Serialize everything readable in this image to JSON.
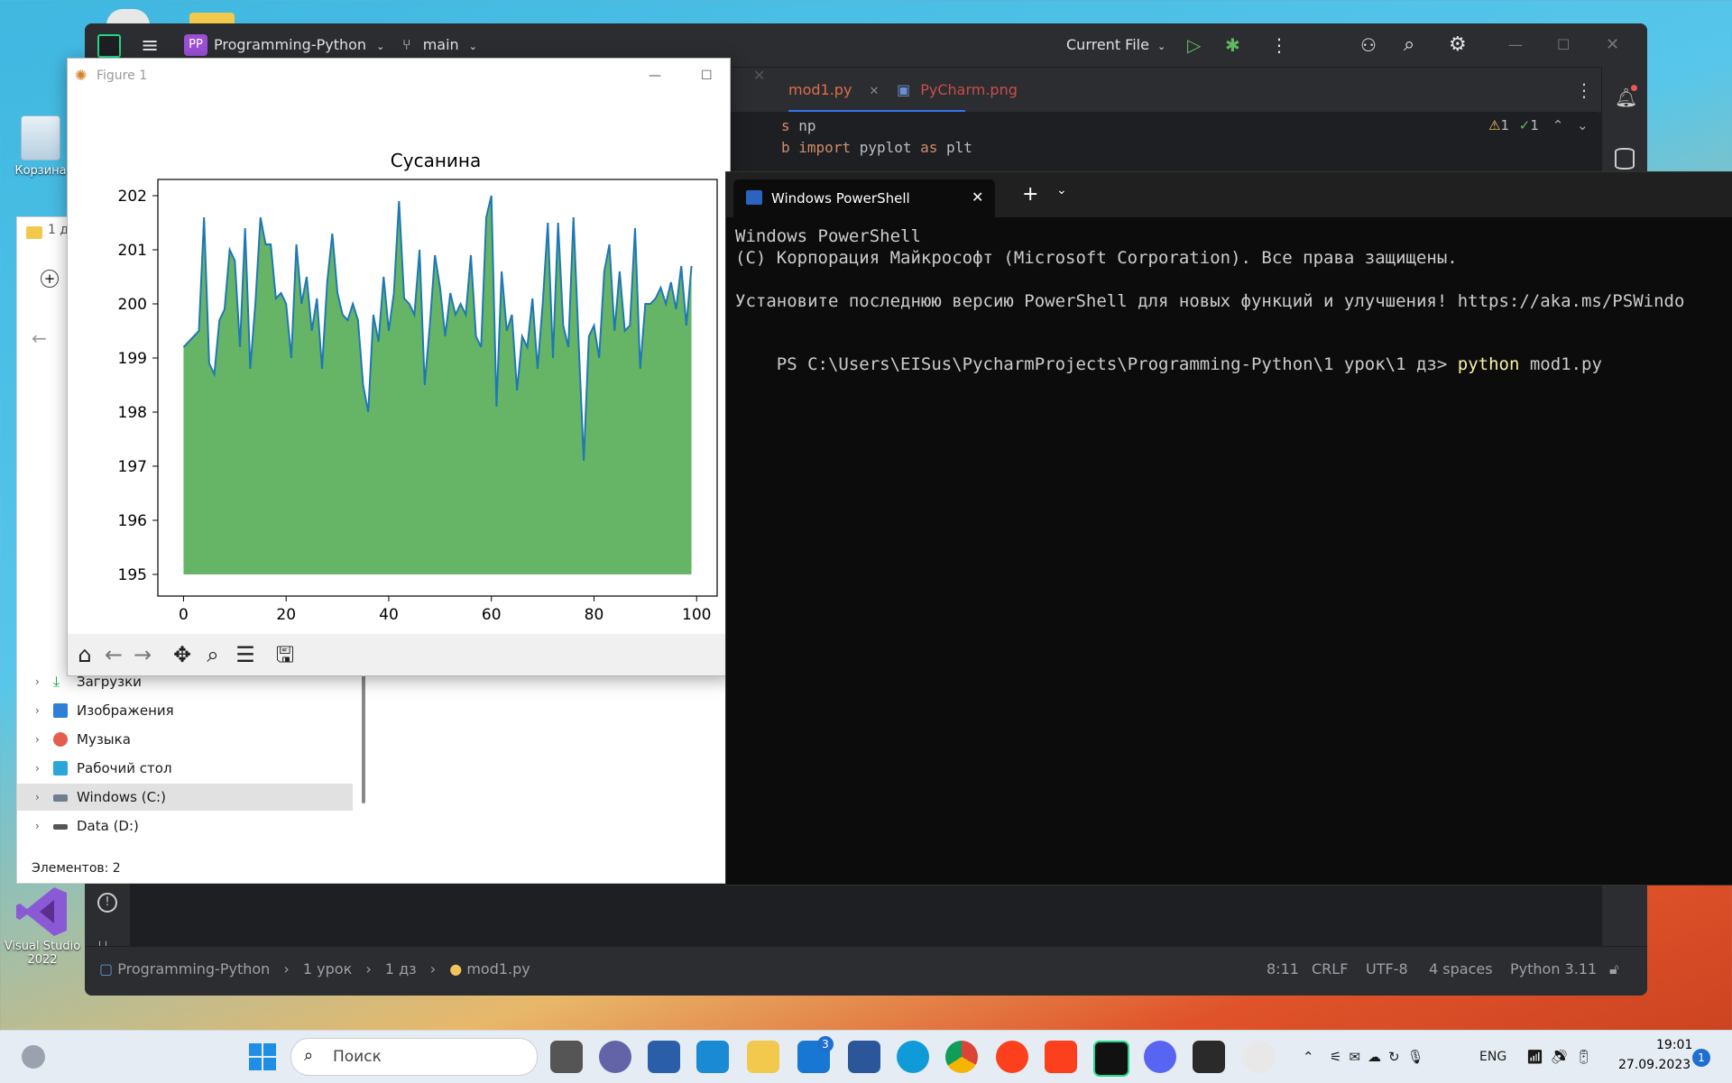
{
  "desktop": {
    "recycle_bin_label": "Корзина",
    "vs_label_1": "Visual Studio",
    "vs_label_2": "2022"
  },
  "pycharm": {
    "project_badge": "PP",
    "project_name": "Programming-Python",
    "branch": "main",
    "run_config": "Current File",
    "tabs": [
      {
        "label": "mod1.py",
        "active": true
      },
      {
        "label": "PyCharm.png",
        "active": false
      }
    ],
    "code_lines": [
      {
        "kw": "s",
        "rest": " np"
      },
      {
        "kw": "b",
        "kw2": "import",
        "rest": " pyplot ",
        "kw3": "as",
        "rest2": " plt"
      }
    ],
    "inspections": {
      "warnings": "1",
      "ok": "1"
    },
    "status": {
      "breadcrumbs": [
        "Programming-Python",
        "1 урок",
        "1 дз",
        "mod1.py"
      ],
      "position": "8:11",
      "line_sep": "CRLF",
      "encoding": "UTF-8",
      "indent": "4 spaces",
      "interpreter": "Python 3.11"
    }
  },
  "explorer": {
    "title_partial": "1 д",
    "tree": [
      {
        "label": "Загрузки",
        "icon": "download-icon"
      },
      {
        "label": "Изображения",
        "icon": "images-icon"
      },
      {
        "label": "Музыка",
        "icon": "music-icon"
      },
      {
        "label": "Рабочий стол",
        "icon": "desktop-icon"
      },
      {
        "label": "Windows (C:)",
        "icon": "drive-icon",
        "selected": true
      },
      {
        "label": "Data (D:)",
        "icon": "drive-icon"
      }
    ],
    "status": "Элементов: 2"
  },
  "figure": {
    "window_title": "Figure 1",
    "chart_data": {
      "type": "area",
      "title": "Сусанина",
      "xlabel": "",
      "ylabel": "",
      "xlim": [
        -5,
        104
      ],
      "ylim": [
        194.6,
        202.3
      ],
      "xticks": [
        0,
        20,
        40,
        60,
        80,
        100
      ],
      "yticks": [
        195,
        196,
        197,
        198,
        199,
        200,
        201,
        202
      ],
      "fill_base": 195,
      "line_color": "#1f77b4",
      "fill_color": "#66b566",
      "grid": false,
      "x": [
        0,
        1,
        2,
        3,
        4,
        5,
        6,
        7,
        8,
        9,
        10,
        11,
        12,
        13,
        14,
        15,
        16,
        17,
        18,
        19,
        20,
        21,
        22,
        23,
        24,
        25,
        26,
        27,
        28,
        29,
        30,
        31,
        32,
        33,
        34,
        35,
        36,
        37,
        38,
        39,
        40,
        41,
        42,
        43,
        44,
        45,
        46,
        47,
        48,
        49,
        50,
        51,
        52,
        53,
        54,
        55,
        56,
        57,
        58,
        59,
        60,
        61,
        62,
        63,
        64,
        65,
        66,
        67,
        68,
        69,
        70,
        71,
        72,
        73,
        74,
        75,
        76,
        77,
        78,
        79,
        80,
        81,
        82,
        83,
        84,
        85,
        86,
        87,
        88,
        89,
        90,
        91,
        92,
        93,
        94,
        95,
        96,
        97,
        98,
        99
      ],
      "y": [
        199.2,
        199.3,
        199.4,
        199.5,
        201.6,
        198.9,
        198.7,
        199.7,
        199.9,
        201.0,
        200.8,
        199.2,
        201.4,
        198.8,
        200.0,
        201.6,
        201.1,
        201.1,
        200.1,
        200.2,
        200.0,
        199.0,
        201.1,
        200.0,
        200.5,
        199.5,
        200.1,
        198.8,
        200.4,
        201.3,
        200.2,
        199.8,
        199.7,
        200.0,
        199.7,
        198.5,
        198.0,
        199.8,
        199.3,
        200.5,
        199.5,
        200.2,
        201.9,
        200.1,
        200.0,
        199.8,
        201.0,
        198.5,
        199.6,
        200.9,
        200.3,
        199.4,
        200.2,
        199.8,
        200.0,
        199.8,
        200.9,
        199.4,
        199.2,
        201.6,
        202.0,
        198.1,
        200.6,
        199.5,
        199.8,
        198.4,
        199.4,
        199.2,
        200.1,
        198.8,
        200.0,
        201.5,
        199.0,
        201.5,
        199.6,
        199.2,
        201.6,
        199.3,
        197.1,
        199.4,
        199.6,
        199.0,
        200.6,
        201.1,
        199.5,
        200.6,
        199.5,
        199.6,
        201.4,
        198.8,
        200.0,
        200.0,
        200.1,
        200.3,
        200.0,
        200.4,
        199.9,
        200.7,
        199.6,
        200.7
      ]
    },
    "tick_labels_x": [
      "0",
      "20",
      "40",
      "60",
      "80",
      "100"
    ],
    "tick_labels_y": [
      "202",
      "201",
      "200",
      "199",
      "198",
      "197",
      "196",
      "195"
    ]
  },
  "terminal": {
    "tab_title": "Windows PowerShell",
    "lines": [
      "Windows PowerShell",
      "(C) Корпорация Майкрософт (Microsoft Corporation). Все права защищены.",
      "",
      "Установите последнюю версию PowerShell для новых функций и улучшения! https://aka.ms/PSWindo",
      ""
    ],
    "prompt": "PS C:\\Users\\EISus\\PycharmProjects\\Programming-Python\\1 урок\\1 дз> ",
    "command_keyword": "python",
    "command_args": " mod1.py"
  },
  "taskbar": {
    "search_placeholder": "Поиск",
    "mail_badge": "3",
    "language": "ENG",
    "time": "19:01",
    "date": "27.09.2023",
    "notification_count": "1"
  }
}
